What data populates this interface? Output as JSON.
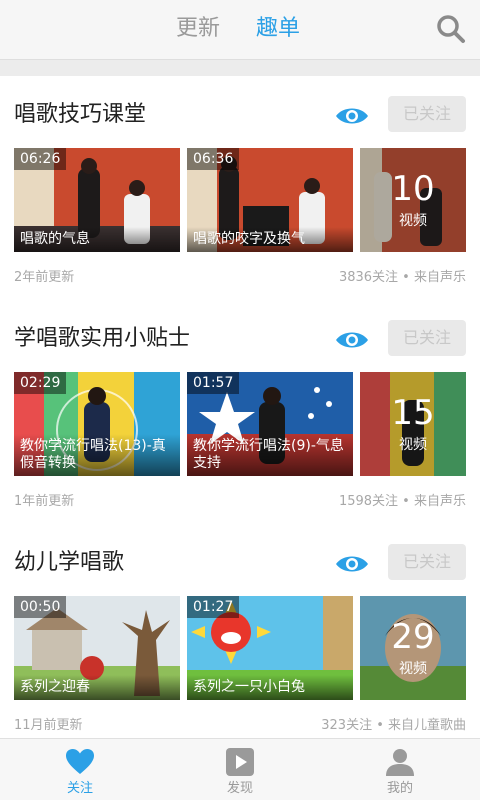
{
  "header": {
    "tabs": [
      {
        "label": "更新"
      },
      {
        "label": "趣单"
      }
    ]
  },
  "cards": [
    {
      "title": "唱歌技巧课堂",
      "follow_label": "已关注",
      "videos": [
        {
          "duration": "06:26",
          "caption": "唱歌的气息"
        },
        {
          "duration": "06:36",
          "caption": "唱歌的咬字及换气"
        }
      ],
      "more": {
        "count": "10",
        "unit": "视频"
      },
      "updated": "2年前更新",
      "stats": "3836关注 • 来自声乐"
    },
    {
      "title": "学唱歌实用小贴士",
      "follow_label": "已关注",
      "videos": [
        {
          "duration": "02:29",
          "caption": "教你学流行唱法(13)-真假音转换"
        },
        {
          "duration": "01:57",
          "caption": "教你学流行唱法(9)-气息支持"
        }
      ],
      "more": {
        "count": "15",
        "unit": "视频"
      },
      "updated": "1年前更新",
      "stats": "1598关注 • 来自声乐"
    },
    {
      "title": "幼儿学唱歌",
      "follow_label": "已关注",
      "videos": [
        {
          "duration": "00:50",
          "caption": "系列之迎春"
        },
        {
          "duration": "01:27",
          "caption": "系列之一只小白兔"
        }
      ],
      "more": {
        "count": "29",
        "unit": "视频"
      },
      "updated": "11月前更新",
      "stats": "323关注 • 来自儿童歌曲"
    }
  ],
  "bottom_nav": [
    {
      "label": "关注",
      "icon": "heart-icon"
    },
    {
      "label": "发现",
      "icon": "play-icon"
    },
    {
      "label": "我的",
      "icon": "person-icon"
    }
  ],
  "colors": {
    "accent": "#2ba0e6",
    "follow_bg": "#e9e9e9",
    "page_bg": "#ececec"
  }
}
